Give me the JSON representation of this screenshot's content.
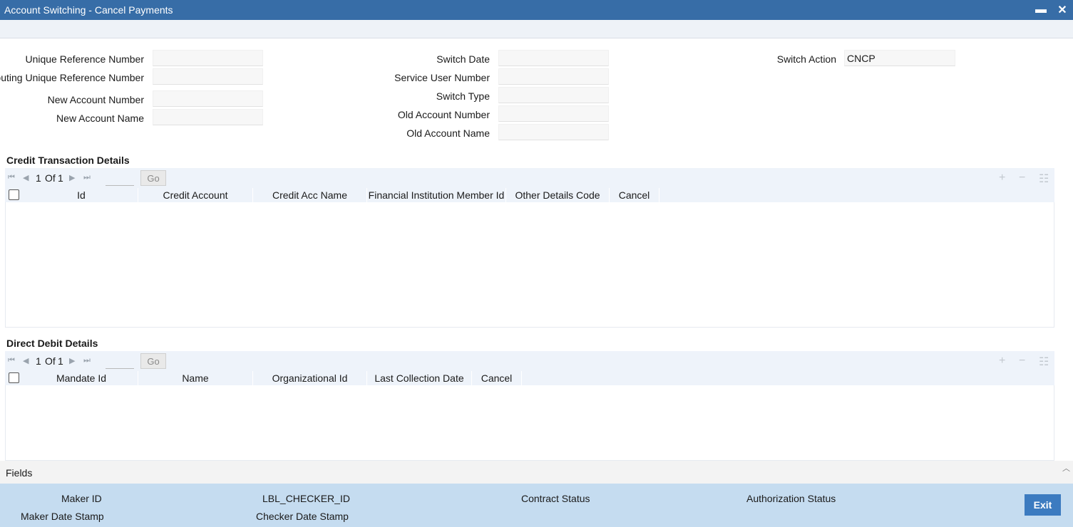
{
  "window": {
    "title": "Account Switching - Cancel Payments",
    "minimize_glyph": "▬",
    "close_glyph": "✕"
  },
  "form": {
    "unique_reference_number": {
      "label": "Unique Reference Number",
      "value": ""
    },
    "routing_unique_reference_number": {
      "label": "Routing Unique Reference Number",
      "value": ""
    },
    "new_account_number": {
      "label": "New Account Number",
      "value": ""
    },
    "new_account_name": {
      "label": "New Account Name",
      "value": ""
    },
    "switch_date": {
      "label": "Switch Date",
      "value": ""
    },
    "service_user_number": {
      "label": "Service User Number",
      "value": ""
    },
    "switch_type": {
      "label": "Switch Type",
      "value": ""
    },
    "old_account_number": {
      "label": "Old Account Number",
      "value": ""
    },
    "old_account_name": {
      "label": "Old Account Name",
      "value": ""
    },
    "switch_action": {
      "label": "Switch Action",
      "value": "CNCP"
    }
  },
  "credit_grid": {
    "title": "Credit Transaction Details",
    "pager": {
      "current": "1",
      "of_label": "Of",
      "total": "1",
      "go_label": "Go"
    },
    "columns": [
      "Id",
      "Credit Account",
      "Credit Acc Name",
      "Financial Institution Member Id",
      "Other Details Code",
      "Cancel"
    ]
  },
  "debit_grid": {
    "title": "Direct Debit Details",
    "pager": {
      "current": "1",
      "of_label": "Of",
      "total": "1",
      "go_label": "Go"
    },
    "columns": [
      "Mandate Id",
      "Name",
      "Organizational Id",
      "Last Collection Date",
      "Cancel"
    ]
  },
  "fields_bar": {
    "label": "Fields"
  },
  "audit": {
    "maker_id": "Maker ID",
    "checker_id": "LBL_CHECKER_ID",
    "contract_status": "Contract Status",
    "authorization_status": "Authorization Status",
    "maker_date_stamp": "Maker Date Stamp",
    "checker_date_stamp": "Checker Date Stamp",
    "exit_label": "Exit"
  },
  "colors": {
    "titlebar": "#376da7",
    "audit_bar": "#c5dcf0",
    "exit_button": "#3c7bc0",
    "grid_header": "#eef3fa"
  }
}
